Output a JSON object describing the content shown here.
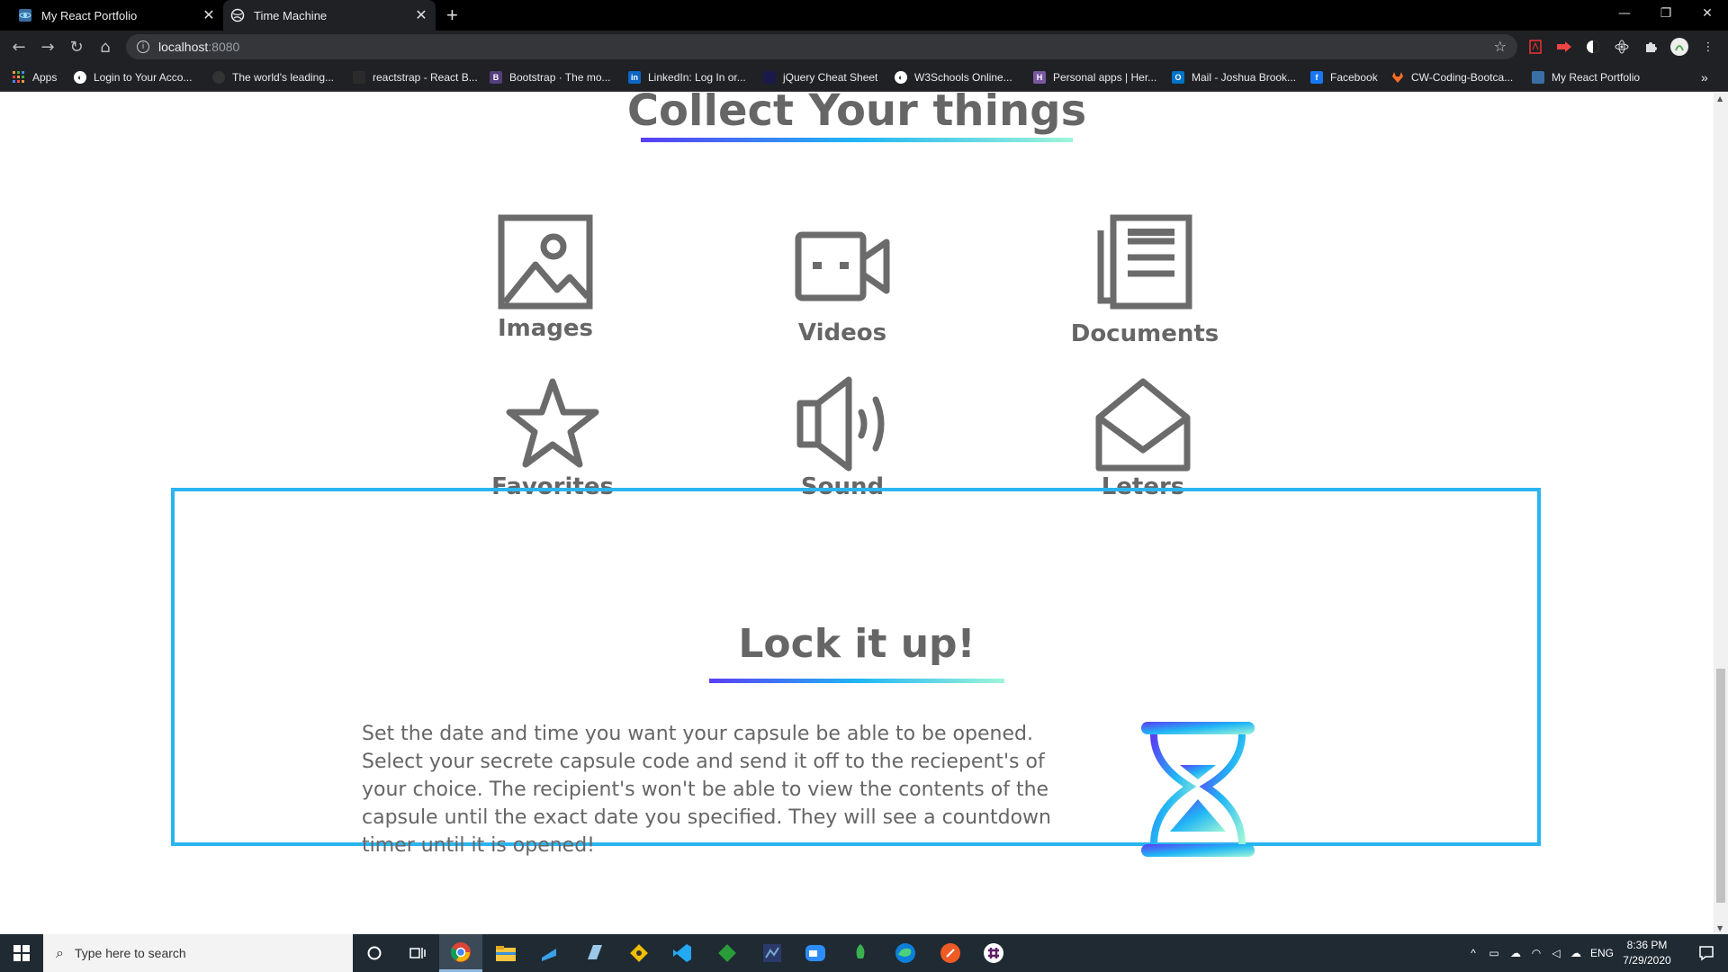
{
  "browser": {
    "tabs": [
      {
        "title": "My React Portfolio",
        "active": false
      },
      {
        "title": "Time Machine",
        "active": true
      }
    ],
    "url_host": "localhost",
    "url_port": ":8080",
    "bookmarks": [
      "Apps",
      "Login to Your Acco...",
      "The world's leading...",
      "reactstrap - React B...",
      "Bootstrap · The mo...",
      "LinkedIn: Log In or...",
      "jQuery Cheat Sheet",
      "W3Schools Online...",
      "Personal apps | Her...",
      "Mail - Joshua Brook...",
      "Facebook",
      "CW-Coding-Bootca...",
      "My React Portfolio"
    ],
    "bookmarks_overflow": "»"
  },
  "collect": {
    "title": "Collect Your things",
    "items": [
      {
        "label": "Images",
        "icon": "image-icon"
      },
      {
        "label": "Videos",
        "icon": "video-camera-icon"
      },
      {
        "label": "Documents",
        "icon": "documents-icon"
      },
      {
        "label": "Favorites",
        "icon": "star-icon"
      },
      {
        "label": "Sound",
        "icon": "speaker-icon"
      },
      {
        "label": "Leters",
        "icon": "envelope-open-icon"
      }
    ]
  },
  "lock": {
    "title": "Lock it up!",
    "text": "Set the date and time you want your capsule be able to be opened. Select your secrete capsule code and send it off to the reciepent's of your choice. The recipient's won't be able to view the contents of the capsule until the exact date you specified. They will see a countdown timer until it is opened!",
    "icon": "hourglass-icon"
  },
  "colors": {
    "accent_border": "#2ab4f0",
    "gradient": [
      "#5a3df5",
      "#20b6f5",
      "#9ef6d8"
    ],
    "text_gray": "#666666"
  },
  "taskbar": {
    "search_placeholder": "Type here to search",
    "language": "ENG",
    "time": "8:36 PM",
    "date": "7/29/2020"
  }
}
